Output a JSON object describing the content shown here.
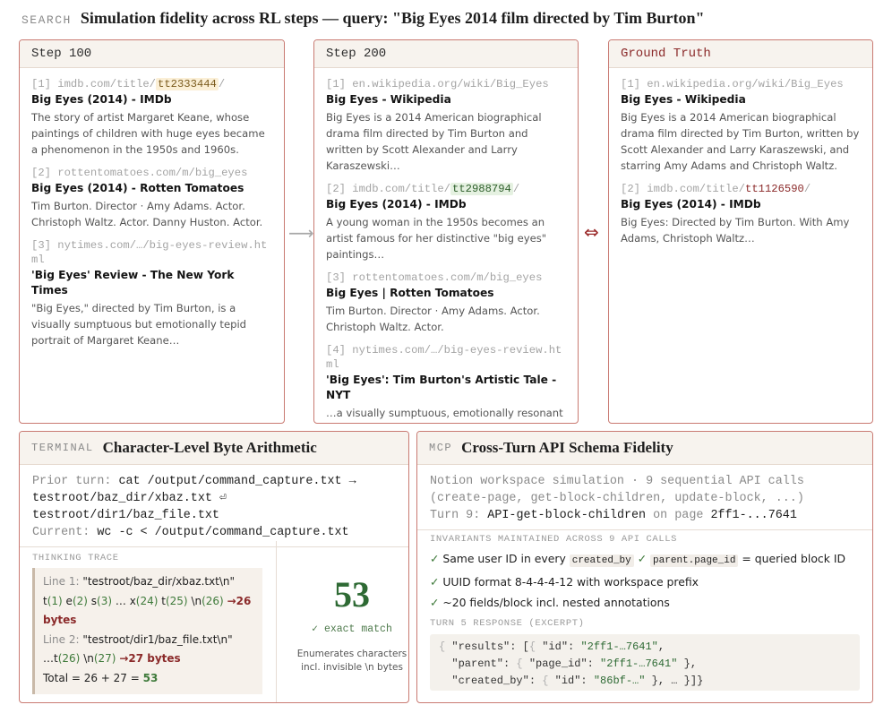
{
  "header": {
    "tag": "SEARCH",
    "title": "Simulation fidelity across RL steps — query: \"Big Eyes 2014 film directed by Tim Burton\""
  },
  "panels": [
    {
      "title": "Step 100",
      "results": [
        {
          "idx": "[1]",
          "url_pre": "imdb.com/title/",
          "url_hl": "tt2333444",
          "url_post": "/",
          "title": "Big Eyes (2014) - IMDb",
          "snippet": "The story of artist Margaret Keane, whose paintings of children with huge eyes became a phenomenon in the 1950s and 1960s."
        },
        {
          "idx": "[2]",
          "url_pre": "rottentomatoes.com/m/big_eyes",
          "url_hl": "",
          "url_post": "",
          "title": "Big Eyes (2014) - Rotten Tomatoes",
          "snippet": "Tim Burton. Director · Amy Adams. Actor. Christoph Waltz. Actor. Danny Huston. Actor."
        },
        {
          "idx": "[3]",
          "url_pre": "nytimes.com/…/big-eyes-review.html",
          "url_hl": "",
          "url_post": "",
          "title": "'Big Eyes' Review - The New York Times",
          "snippet": "\"Big Eyes,\" directed by Tim Burton, is a visually sumptuous but emotionally tepid portrait of Margaret Keane…"
        }
      ]
    },
    {
      "title": "Step 200",
      "results": [
        {
          "idx": "[1]",
          "url_pre": "en.wikipedia.org/wiki/Big_Eyes",
          "url_hl": "",
          "url_post": "",
          "title": "Big Eyes - Wikipedia",
          "snippet": "Big Eyes is a 2014 American biographical drama film directed by Tim Burton and written by Scott Alexander and Larry Karaszewski…"
        },
        {
          "idx": "[2]",
          "url_pre": "imdb.com/title/",
          "url_hl": "tt2988794",
          "url_post": "/",
          "title": "Big Eyes (2014) - IMDb",
          "snippet": "A young woman in the 1950s becomes an artist famous for her distinctive \"big eyes\" paintings…"
        },
        {
          "idx": "[3]",
          "url_pre": "rottentomatoes.com/m/big_eyes",
          "url_hl": "",
          "url_post": "",
          "title": "Big Eyes | Rotten Tomatoes",
          "snippet": "Tim Burton. Director · Amy Adams. Actor. Christoph Waltz. Actor."
        },
        {
          "idx": "[4]",
          "url_pre": "nytimes.com/…/big-eyes-review.html",
          "url_hl": "",
          "url_post": "",
          "title": "'Big Eyes': Tim Burton's Artistic Tale - NYT",
          "snippet": "…a visually sumptuous, emotionally resonant film about Margaret Keane…"
        }
      ]
    },
    {
      "title": "Ground Truth",
      "results": [
        {
          "idx": "[1]",
          "url_pre": "en.wikipedia.org/wiki/Big_Eyes",
          "url_hl": "",
          "url_post": "",
          "title": "Big Eyes - Wikipedia",
          "snippet": "Big Eyes is a 2014 American biographical drama film directed by Tim Burton, written by Scott Alexander and Larry Karaszewski, and starring Amy Adams and Christoph Waltz."
        },
        {
          "idx": "[2]",
          "url_pre": "imdb.com/title/",
          "url_hl": "tt1126590",
          "url_post": "/",
          "title": "Big Eyes (2014) - IMDb",
          "snippet": "Big Eyes: Directed by Tim Burton. With Amy Adams, Christoph Waltz…"
        }
      ]
    }
  ],
  "arrows": {
    "step": "⟶",
    "truth": "⇔"
  },
  "terminal": {
    "tag": "TERMINAL",
    "title": "Character-Level Byte Arithmetic",
    "prior_label": "Prior turn:",
    "prior_cmd": "cat /output/command_capture.txt →",
    "line2": "testroot/baz_dir/xbaz.txt ⏎",
    "line3": "testroot/dir1/baz_file.txt",
    "current_label": "Current:",
    "current_cmd": "wc -c < /output/command_capture.txt",
    "trace_label": "THINKING TRACE",
    "trace": {
      "l1_label": "Line 1:",
      "l1_text": "\"testroot/baz_dir/xbaz.txt\\n\"",
      "l1_chars": [
        {
          "c": "t",
          "n": "(1)"
        },
        {
          "c": "e",
          "n": "(2)"
        },
        {
          "c": "s",
          "n": "(3)"
        }
      ],
      "l1_ellipsis": "…",
      "l1_chars2": [
        {
          "c": "x",
          "n": "(24)"
        },
        {
          "c": "t",
          "n": "(25)"
        },
        {
          "c": "\\n",
          "n": "(26)"
        }
      ],
      "l1_result": "→26 bytes",
      "l2_label": "Line 2:",
      "l2_text": "\"testroot/dir1/baz_file.txt\\n\"",
      "l2_ellipsis": "…",
      "l2_chars": [
        {
          "c": "t",
          "n": "(26)"
        },
        {
          "c": "\\n",
          "n": "(27)"
        }
      ],
      "l2_result": "→27 bytes",
      "total_label": "Total = 26 + 27 =",
      "total_value": "53"
    },
    "result_value": "53",
    "result_match": "✓ exact match",
    "result_note_1": "Enumerates characters",
    "result_note_2": "incl. invisible \\n bytes"
  },
  "mcp": {
    "tag": "MCP",
    "title": "Cross-Turn API Schema Fidelity",
    "desc_1": "Notion workspace simulation · 9 sequential API calls",
    "desc_2": "(create-page, get-block-children, update-block, ...)",
    "desc_3_pre": "Turn 9:",
    "desc_3_api": "API-get-block-children",
    "desc_3_mid": "on page",
    "desc_3_page": "2ff1-...7641",
    "inv_label": "INVARIANTS MAINTAINED ACROSS 9 API CALLS",
    "inv_1_pre": "Same user ID in every",
    "inv_1_code1": "created_by",
    "inv_1_code2": "parent.page_id",
    "inv_1_post": "= queried block ID",
    "inv_2": "UUID format 8-4-4-4-12 with workspace prefix",
    "inv_3": "~20 fields/block incl. nested annotations",
    "check": "✓",
    "resp_label": "TURN 5 RESPONSE (EXCERPT)",
    "json_1a": "{ ",
    "json_1b": "\"results\": [",
    "json_1c": "{ ",
    "json_1d": "\"id\": ",
    "json_1e": "\"2ff1-…7641\"",
    "json_1f": ",",
    "json_2a": "  \"parent\": ",
    "json_2b": "{ ",
    "json_2c": "\"page_id\": ",
    "json_2d": "\"2ff1-…7641\"",
    "json_2e": " },",
    "json_3a": "  \"created_by\": ",
    "json_3b": "{ ",
    "json_3c": "\"id\": ",
    "json_3d": "\"86bf-…\"",
    "json_3e": " }, … }]}"
  }
}
